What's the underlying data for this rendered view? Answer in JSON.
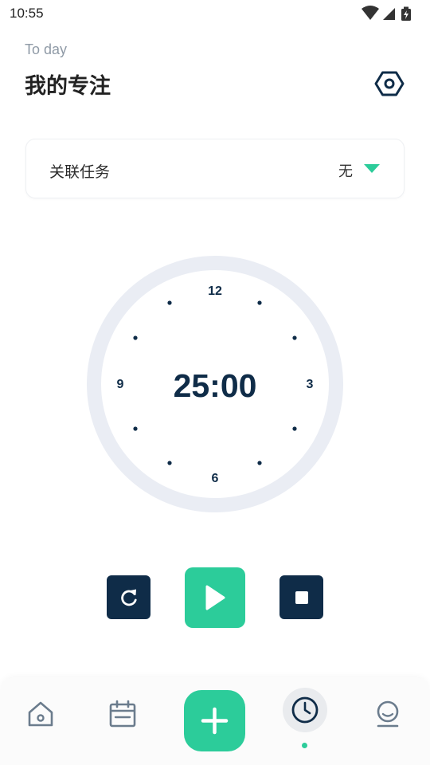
{
  "status_bar": {
    "time": "10:55"
  },
  "header": {
    "subtitle": "To day",
    "title": "我的专注"
  },
  "task": {
    "label": "关联任务",
    "value": "无"
  },
  "timer": {
    "display": "25:00",
    "labels": {
      "top": "12",
      "right": "3",
      "bottom": "6",
      "left": "9"
    }
  },
  "colors": {
    "accent": "#2ccc9a",
    "dark": "#0f2c48",
    "ring": "#eaedf4",
    "muted": "#8f9aa6"
  },
  "icons": {
    "settings": "hexagon-gear-icon",
    "reset": "refresh-icon",
    "play": "play-icon",
    "stop": "stop-icon",
    "home": "home-icon",
    "calendar": "calendar-icon",
    "add": "plus-icon",
    "timer": "clock-icon",
    "profile": "profile-icon"
  }
}
